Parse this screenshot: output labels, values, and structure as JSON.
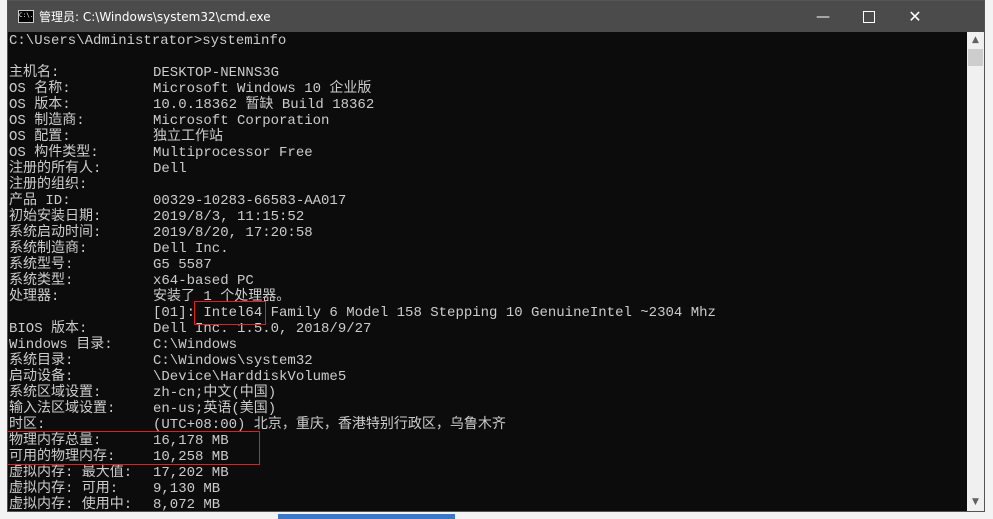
{
  "window": {
    "title": "管理员: C:\\Windows\\system32\\cmd.exe",
    "icon": "cmd-icon",
    "icon_text": "C:\\."
  },
  "console": {
    "prompt": "C:\\Users\\Administrator>systeminfo",
    "rows": [
      {
        "label": "主机名:",
        "value": "DESKTOP-NENNS3G"
      },
      {
        "label": "OS 名称:",
        "value": "Microsoft Windows 10 企业版"
      },
      {
        "label": "OS 版本:",
        "value": "10.0.18362 暂缺 Build 18362"
      },
      {
        "label": "OS 制造商:",
        "value": "Microsoft Corporation"
      },
      {
        "label": "OS 配置:",
        "value": "独立工作站"
      },
      {
        "label": "OS 构件类型:",
        "value": "Multiprocessor Free"
      },
      {
        "label": "注册的所有人:",
        "value": "Dell"
      },
      {
        "label": "注册的组织:",
        "value": ""
      },
      {
        "label": "产品 ID:",
        "value": "00329-10283-66583-AA017"
      },
      {
        "label": "初始安装日期:",
        "value": "2019/8/3, 11:15:52"
      },
      {
        "label": "系统启动时间:",
        "value": "2019/8/20, 17:20:58"
      },
      {
        "label": "系统制造商:",
        "value": "Dell Inc."
      },
      {
        "label": "系统型号:",
        "value": "G5 5587"
      },
      {
        "label": "系统类型:",
        "value": "x64-based PC"
      },
      {
        "label": "处理器:",
        "value": "安装了 1 个处理器。"
      },
      {
        "label": "",
        "value": "[01]: Intel64 Family 6 Model 158 Stepping 10 GenuineIntel ~2304 Mhz"
      },
      {
        "label": "BIOS 版本:",
        "value": "Dell Inc. 1.5.0, 2018/9/27"
      },
      {
        "label": "Windows 目录:",
        "value": "C:\\Windows"
      },
      {
        "label": "系统目录:",
        "value": "C:\\Windows\\system32"
      },
      {
        "label": "启动设备:",
        "value": "\\Device\\HarddiskVolume5"
      },
      {
        "label": "系统区域设置:",
        "value": "zh-cn;中文(中国)"
      },
      {
        "label": "输入法区域设置:",
        "value": "en-us;英语(美国)"
      },
      {
        "label": "时区:",
        "value": "(UTC+08:00) 北京，重庆，香港特别行政区，乌鲁木齐"
      },
      {
        "label": "物理内存总量:",
        "value": "16,178 MB"
      },
      {
        "label": "可用的物理内存:",
        "value": "10,258 MB"
      },
      {
        "label": "虚拟内存: 最大值:",
        "value": "17,202 MB"
      },
      {
        "label": "虚拟内存: 可用:",
        "value": "9,130 MB"
      },
      {
        "label": "虚拟内存: 使用中:",
        "value": "8,072 MB"
      }
    ]
  },
  "colors": {
    "console_bg": "#0c0c0c",
    "console_text": "#cccccc",
    "titlebar": "#4b4b4b",
    "highlight_box": "#e02020"
  }
}
